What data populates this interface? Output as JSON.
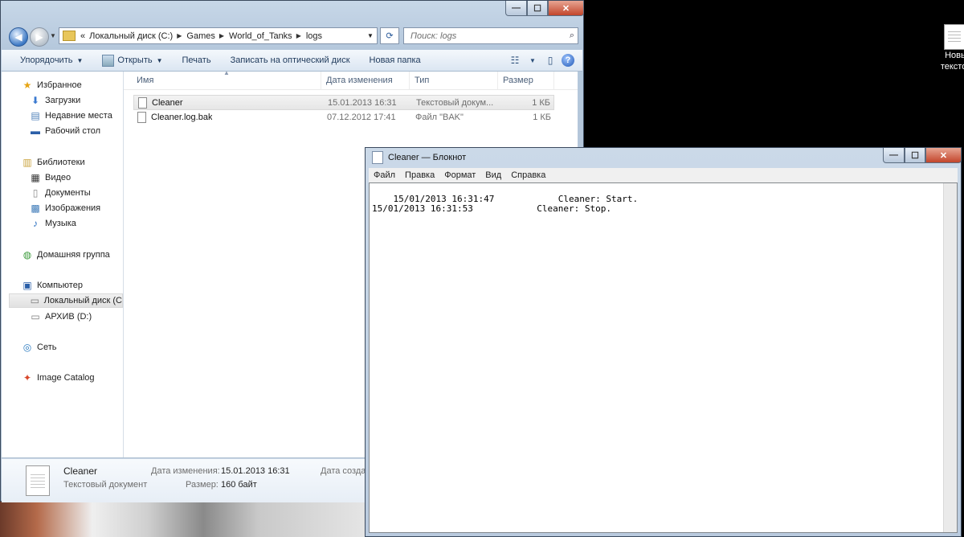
{
  "desktop": {
    "icon_label_1": "Новы",
    "icon_label_2": "текстов"
  },
  "explorer": {
    "caption": {
      "min": "—",
      "max": "☐",
      "close": "✕"
    },
    "address": {
      "overflow": "«",
      "crumbs": [
        "Локальный диск (C:)",
        "Games",
        "World_of_Tanks",
        "logs"
      ]
    },
    "search_placeholder": "Поиск: logs",
    "toolbar": {
      "organize": "Упорядочить",
      "open": "Открыть",
      "print": "Печать",
      "burn": "Записать на оптический диск",
      "new_folder": "Новая папка"
    },
    "nav": {
      "favorites": "Избранное",
      "downloads": "Загрузки",
      "recent": "Недавние места",
      "desktop": "Рабочий стол",
      "libraries": "Библиотеки",
      "video": "Видео",
      "documents": "Документы",
      "images": "Изображения",
      "music": "Музыка",
      "homegroup": "Домашняя группа",
      "computer": "Компьютер",
      "local_disk": "Локальный диск (C",
      "archive": "АРХИВ (D:)",
      "network": "Сеть",
      "image_catalog": "Image Catalog"
    },
    "columns": {
      "name": "Имя",
      "date": "Дата изменения",
      "type": "Тип",
      "size": "Размер"
    },
    "files": [
      {
        "name": "Cleaner",
        "date": "15.01.2013 16:31",
        "type": "Текстовый докум...",
        "size": "1 КБ"
      },
      {
        "name": "Cleaner.log.bak",
        "date": "07.12.2012 17:41",
        "type": "Файл \"BAK\"",
        "size": "1 КБ"
      }
    ],
    "details": {
      "name": "Cleaner",
      "kind": "Текстовый документ",
      "modified_label": "Дата изменения:",
      "modified_value": "15.01.2013 16:31",
      "size_label": "Размер:",
      "size_value": "160 байт",
      "created_label": "Дата созда"
    }
  },
  "notepad": {
    "title": "Cleaner — Блокнот",
    "menu": [
      "Файл",
      "Правка",
      "Формат",
      "Вид",
      "Справка"
    ],
    "content": "15/01/2013 16:31:47            Cleaner: Start.\n15/01/2013 16:31:53            Cleaner: Stop."
  }
}
